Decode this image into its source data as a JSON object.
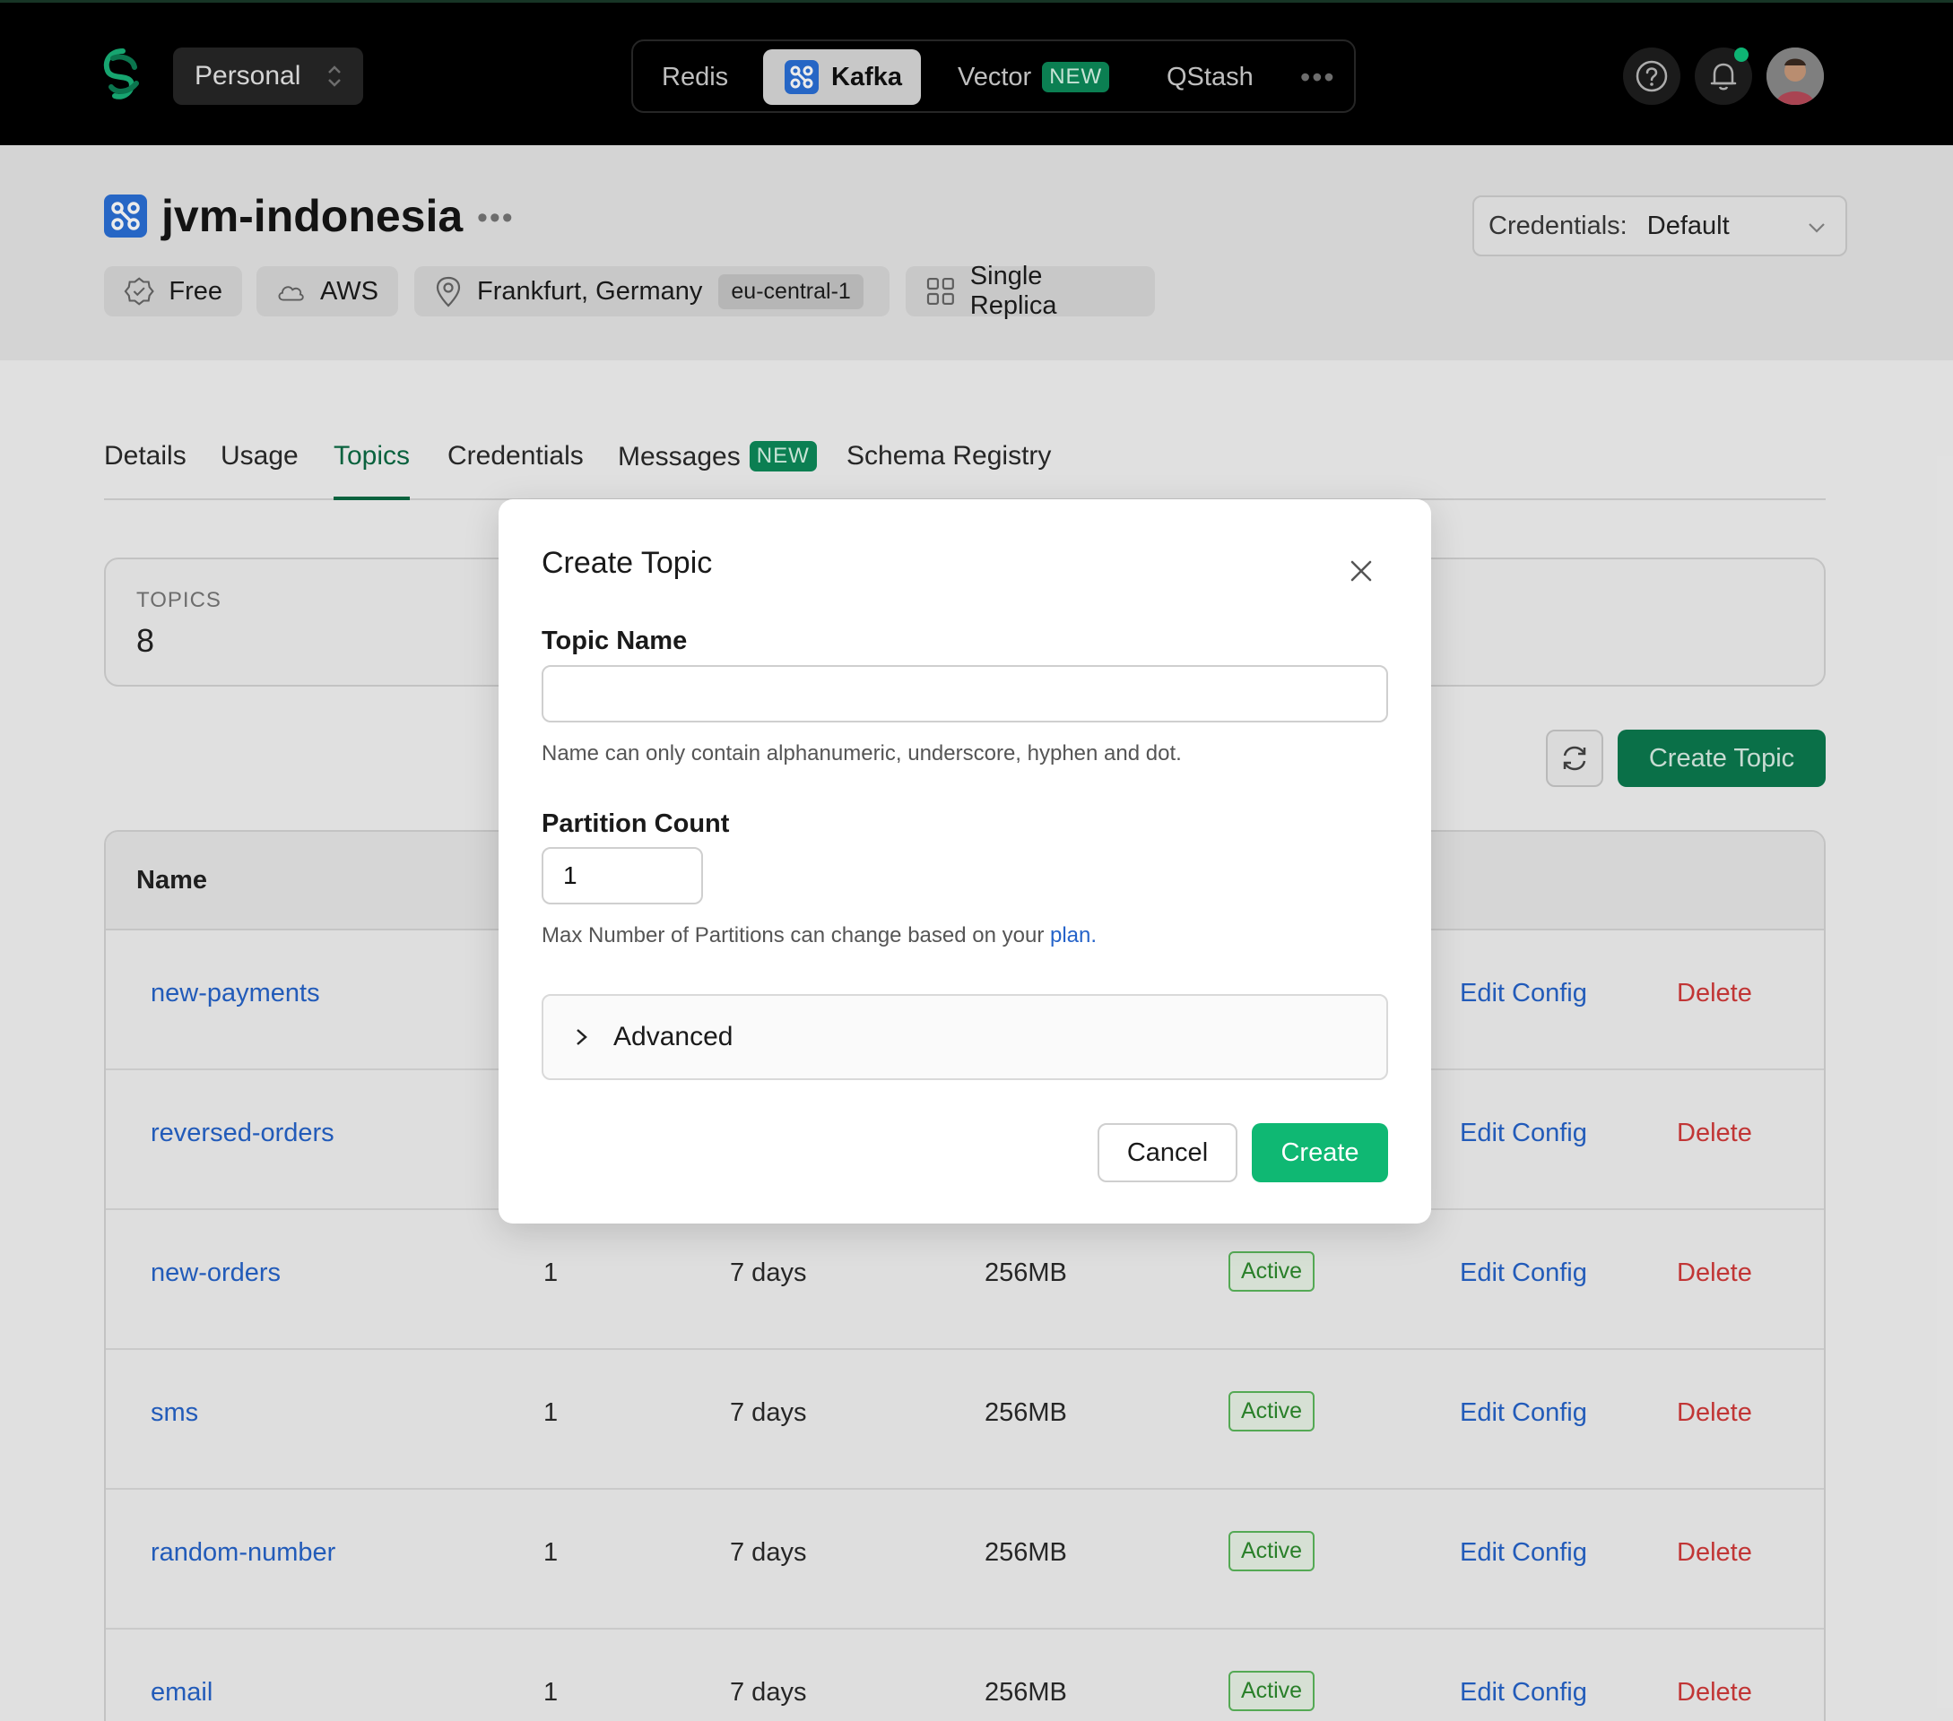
{
  "topbar": {
    "workspace": "Personal",
    "products": {
      "redis": "Redis",
      "kafka": "Kafka",
      "vector": "Vector",
      "vector_badge": "NEW",
      "qstash": "QStash",
      "more": "•••"
    },
    "accent": "#10c47e"
  },
  "header": {
    "title": "jvm-indonesia",
    "more": "•••",
    "chips": {
      "plan": "Free",
      "cloud": "AWS",
      "region": "Frankfurt, Germany",
      "region_code": "eu-central-1",
      "replica": "Single Replica"
    },
    "credentials_label": "Credentials:",
    "credentials_value": "Default"
  },
  "tabs": {
    "details": "Details",
    "usage": "Usage",
    "topics": "Topics",
    "credentials": "Credentials",
    "messages": "Messages",
    "messages_badge": "NEW",
    "schema": "Schema Registry",
    "active": "Topics"
  },
  "stats": {
    "label": "TOPICS",
    "value": "8"
  },
  "actions": {
    "create_topic": "Create Topic"
  },
  "table": {
    "header_name": "Name",
    "rows": [
      {
        "name": "new-payments",
        "partitions": "",
        "retention": "",
        "size": "",
        "status": "",
        "edit": "Edit Config",
        "delete": "Delete"
      },
      {
        "name": "reversed-orders",
        "partitions": "",
        "retention": "",
        "size": "",
        "status": "",
        "edit": "Edit Config",
        "delete": "Delete"
      },
      {
        "name": "new-orders",
        "partitions": "1",
        "retention": "7 days",
        "size": "256MB",
        "status": "Active",
        "edit": "Edit Config",
        "delete": "Delete"
      },
      {
        "name": "sms",
        "partitions": "1",
        "retention": "7 days",
        "size": "256MB",
        "status": "Active",
        "edit": "Edit Config",
        "delete": "Delete"
      },
      {
        "name": "random-number",
        "partitions": "1",
        "retention": "7 days",
        "size": "256MB",
        "status": "Active",
        "edit": "Edit Config",
        "delete": "Delete"
      },
      {
        "name": "email",
        "partitions": "1",
        "retention": "7 days",
        "size": "256MB",
        "status": "Active",
        "edit": "Edit Config",
        "delete": "Delete"
      }
    ]
  },
  "modal": {
    "title": "Create Topic",
    "topic_name_label": "Topic Name",
    "topic_name_value": "",
    "topic_name_hint": "Name can only contain alphanumeric, underscore, hyphen and dot.",
    "partition_label": "Partition Count",
    "partition_value": "1",
    "partition_hint_prefix": "Max Number of Partitions can change based on your ",
    "partition_hint_link": "plan",
    "partition_hint_suffix": ".",
    "advanced": "Advanced",
    "cancel": "Cancel",
    "create": "Create"
  }
}
